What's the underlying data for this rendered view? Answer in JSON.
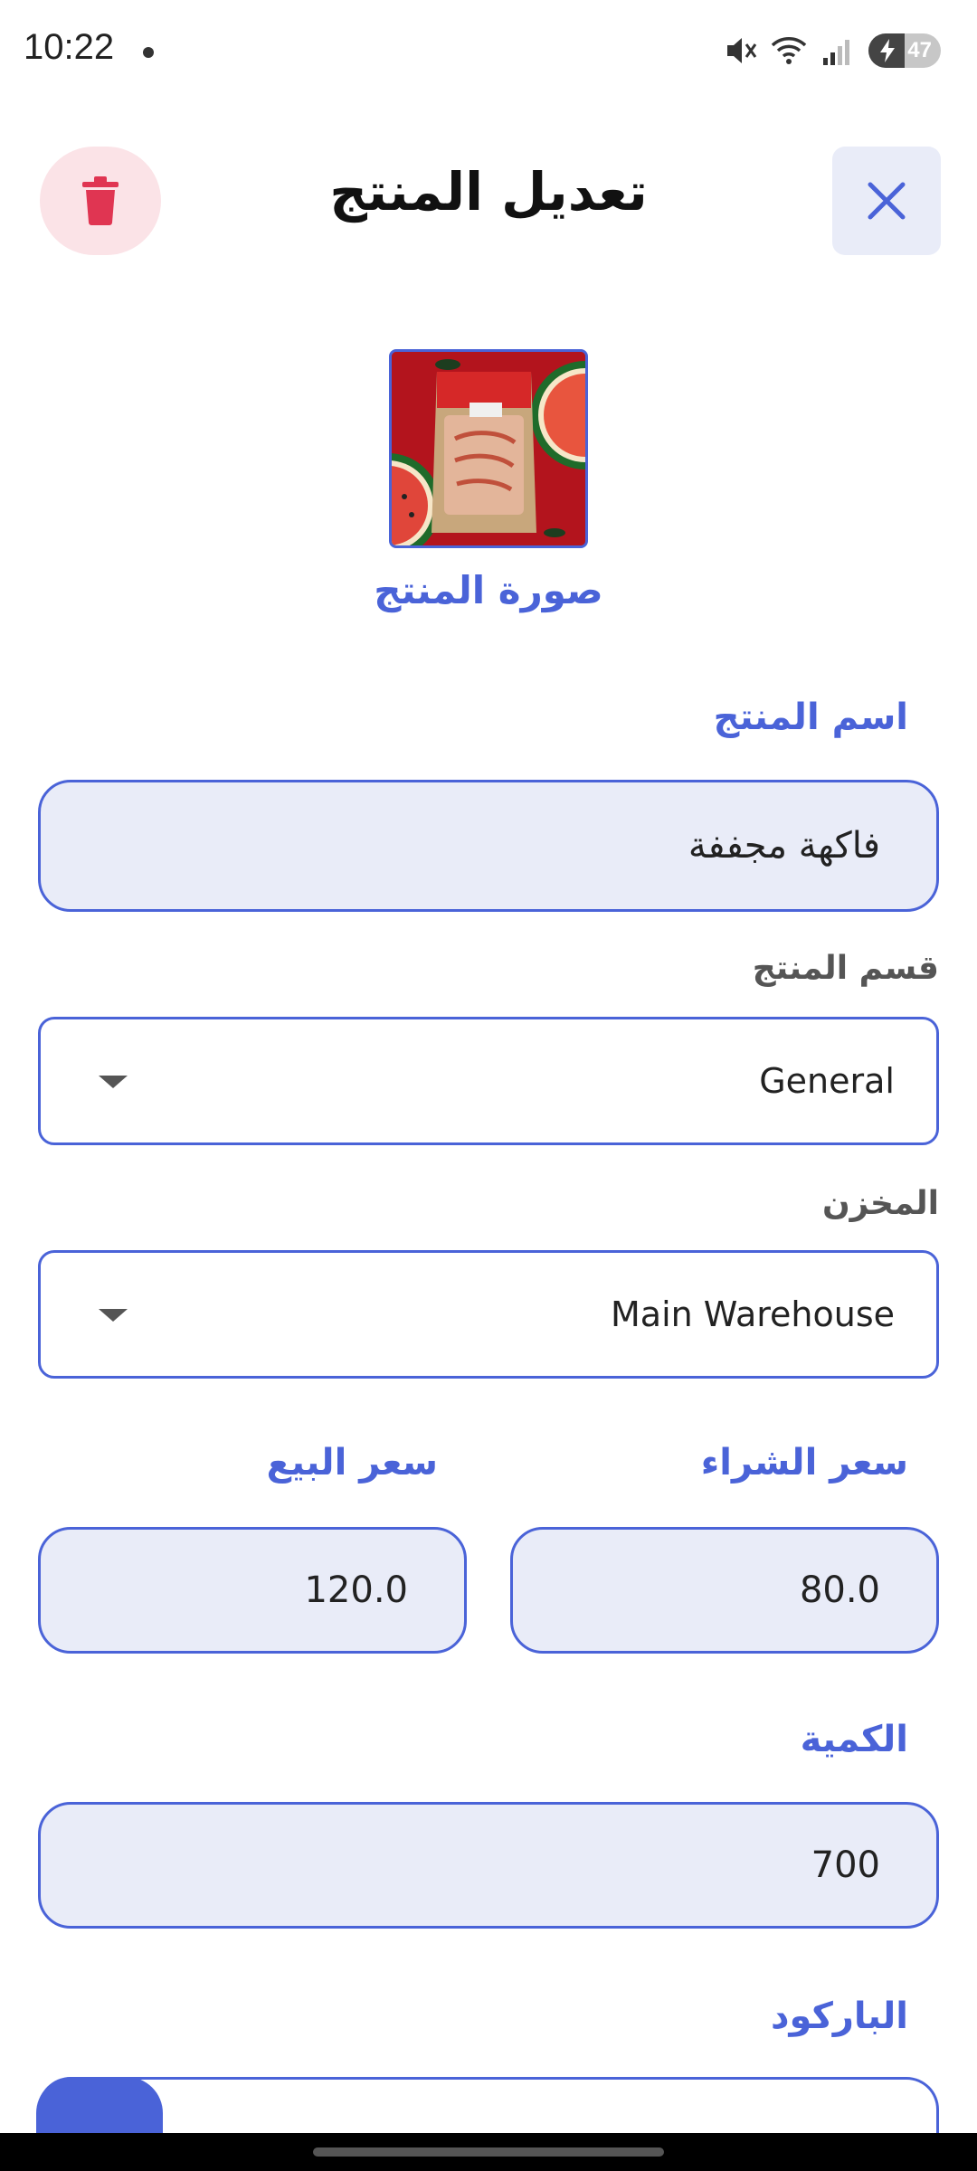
{
  "status_bar": {
    "time": "10:22",
    "battery": "47"
  },
  "header": {
    "title": "تعديل المنتج",
    "close_icon": "close-icon",
    "delete_icon": "trash-icon"
  },
  "image": {
    "label": "صورة المنتج"
  },
  "fields": {
    "name_label": "اسم المنتج",
    "name_value": "فاكهة مجففة",
    "category_label": "قسم المنتج",
    "category_value": "General",
    "warehouse_label": "المخزن",
    "warehouse_value": "Main Warehouse",
    "purchase_price_label": "سعر الشراء",
    "purchase_price_value": "80.0",
    "sale_price_label": "سعر البيع",
    "sale_price_value": "120.0",
    "quantity_label": "الكمية",
    "quantity_value": "700",
    "barcode_label": "الباركود"
  },
  "colors": {
    "accent": "#4a63d8",
    "delete": "#e03552",
    "field_bg": "#e9ecf8"
  }
}
